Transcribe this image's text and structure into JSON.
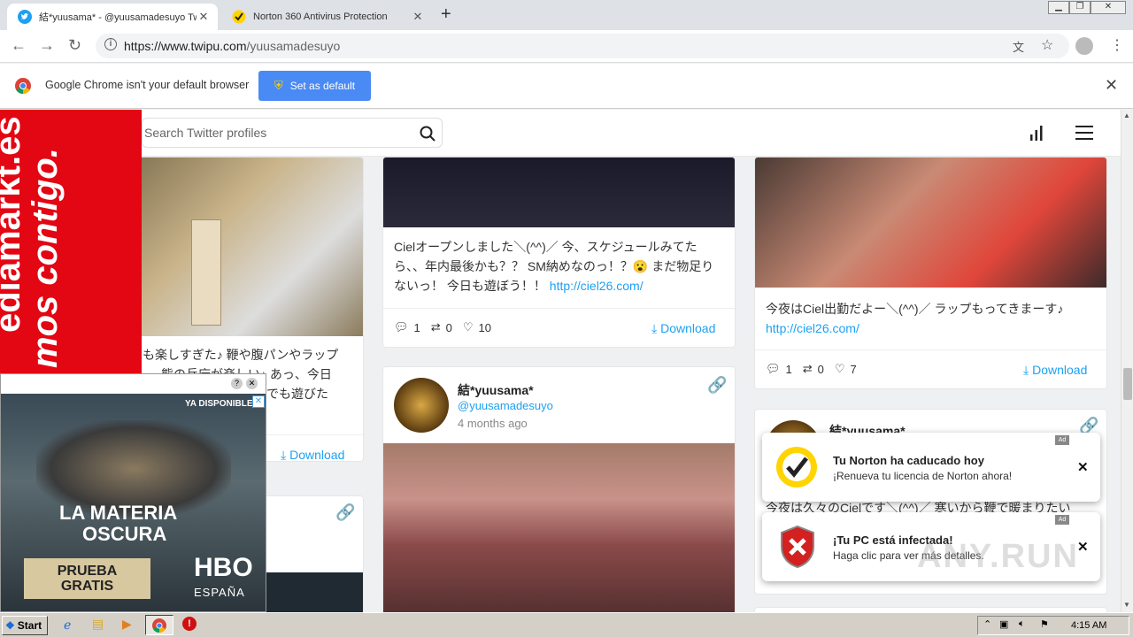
{
  "browser": {
    "tabs": [
      {
        "title": "結*yuusama* - @yuusamadesuyo Twipu",
        "active": true,
        "icon": "twitter-icon"
      },
      {
        "title": "Norton 360 Antivirus Protection",
        "active": false,
        "icon": "norton-check-icon"
      }
    ],
    "url_domain": "https://www.twipu.com",
    "url_path": "/yuusamadesuyo",
    "infobar_text": "Google Chrome isn't your default browser",
    "set_default_label": "Set as default"
  },
  "site": {
    "search_placeholder": "Search Twitter profiles"
  },
  "cards": {
    "c1_text": "も楽しすぎた♪ 鞭や腹パンやラップ 、、熊の兵庁が楽しい♪ あっ、今日 …………の…………欄でも遊びた …………(^^)／",
    "c1_download": "Download",
    "c2_text": "Cielオープンしました＼(^^)／ 今、スケジュールみてたら、、年内最後かも？？ SM納めなのっ！？😮 まだ物足りないっ！ 今日も遊ぼう！！",
    "c2_link": "http://ciel26.com/",
    "c2_replies": "1",
    "c2_retweets": "0",
    "c2_likes": "10",
    "c2_download": "Download",
    "c3_text": "今夜はCiel出勤だよー＼(^^)／ ラップもってきまーす♪",
    "c3_link": "http://ciel26.com/",
    "c3_replies": "1",
    "c3_retweets": "0",
    "c3_likes": "7",
    "c3_download": "Download",
    "c4_user": "結*yuusama*",
    "c4_handle": "@yuusamadesuyo",
    "c4_ago": "4 months ago",
    "c5_user": "結*yuusama*",
    "c5_text_partial": "今夜は久々のCielです＼(^^)／ 寒いから鞭で暖まりたい"
  },
  "ads": {
    "mediamarkt_line1": "ediamarkt.es",
    "mediamarkt_line2": "mos contigo.",
    "hbo_banner": "YA DISPONIBLE",
    "hbo_title1": "LA MATERIA",
    "hbo_title2": "OSCURA",
    "hbo_cta1": "PRUEBA",
    "hbo_cta2": "GRATIS",
    "hbo_brand": "HBO",
    "hbo_country": "ESPAÑA"
  },
  "notifications": [
    {
      "title": "Tu Norton ha caducado hoy",
      "subtitle": "¡Renueva tu licencia de Norton ahora!",
      "ad_label": "Ad"
    },
    {
      "title": "¡Tu PC está infectada!",
      "subtitle": "Haga clic para ver más detalles.",
      "ad_label": "Ad"
    }
  ],
  "taskbar": {
    "start_label": "Start",
    "clock": "4:15 AM"
  },
  "watermark": "ANY.RUN",
  "colors": {
    "accent": "#1da1f2",
    "chrome_button": "#4a8af4",
    "mediamarkt_red": "#e30613"
  }
}
